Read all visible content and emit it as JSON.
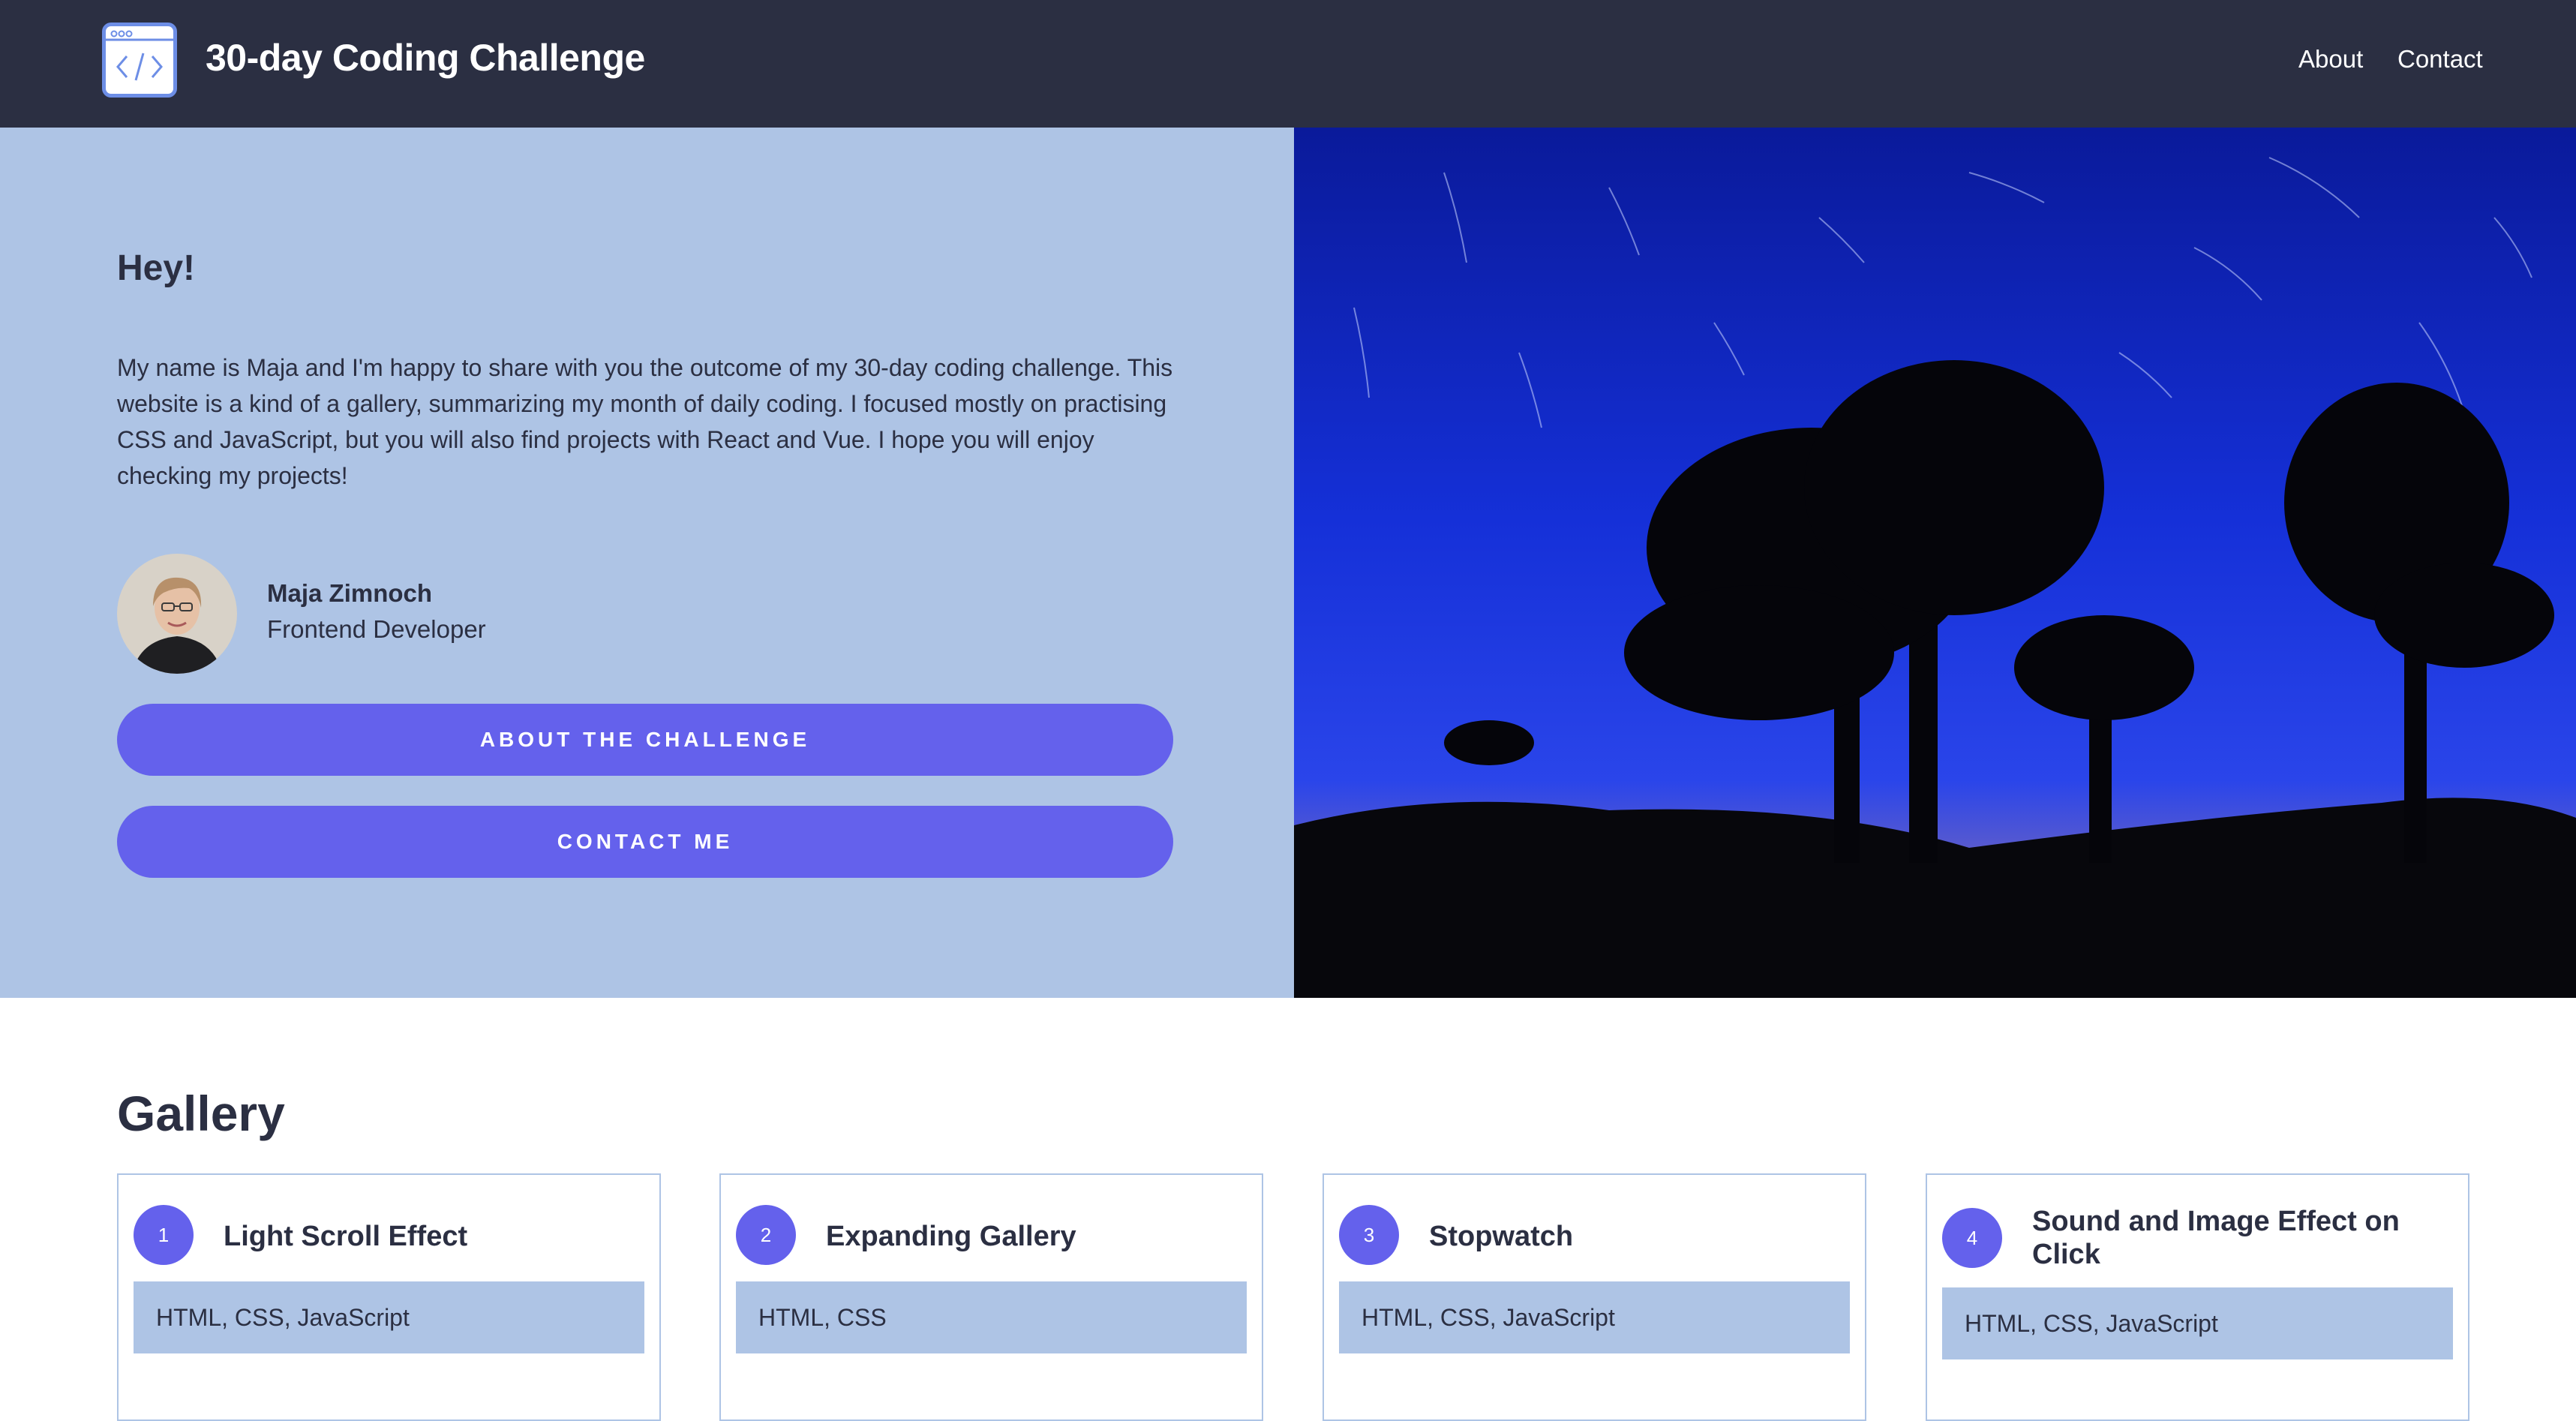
{
  "header": {
    "title": "30-day Coding Challenge",
    "logo_icon": "code-window-icon",
    "nav": [
      {
        "label": "About"
      },
      {
        "label": "Contact"
      }
    ]
  },
  "hero": {
    "greeting": "Hey!",
    "intro": "My name is Maja and I'm happy to share with you the outcome of my 30-day coding challenge. This website is a kind of a gallery, summarizing my month of daily coding. I focused mostly on practising CSS and JavaScript, but you will also find projects with React and Vue. I hope you will enjoy checking my projects!",
    "author": {
      "name": "Maja Zimnoch",
      "role": "Frontend Developer"
    },
    "buttons": {
      "about": "ABOUT THE CHALLENGE",
      "contact": "CONTACT ME"
    },
    "image": "night-sky-star-trails-trees"
  },
  "gallery": {
    "title": "Gallery",
    "cards": [
      {
        "number": "1",
        "title": "Light Scroll Effect",
        "tags": "HTML, CSS, JavaScript"
      },
      {
        "number": "2",
        "title": "Expanding Gallery",
        "tags": "HTML, CSS"
      },
      {
        "number": "3",
        "title": "Stopwatch",
        "tags": "HTML, CSS, JavaScript"
      },
      {
        "number": "4",
        "title": "Sound and Image Effect on Click",
        "tags": "HTML, CSS, JavaScript"
      }
    ]
  },
  "colors": {
    "navbar": "#2b2f42",
    "hero_bg": "#aec4e5",
    "accent": "#6461ec",
    "text": "#2b2f42"
  }
}
